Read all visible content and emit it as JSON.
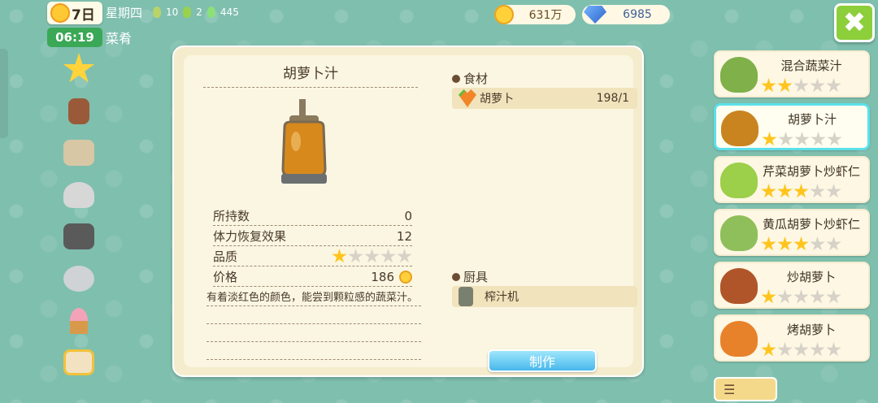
{
  "status": {
    "day": "7日",
    "time": "06:19",
    "weekday": "星期四",
    "stat1": "10",
    "stat2": "2",
    "stat3": "445",
    "category": "菜肴"
  },
  "currency": {
    "gold": "631万",
    "gems": "6985"
  },
  "close_label": "✖",
  "rail": [
    "star-icon",
    "drink-icon",
    "cutting-board-icon",
    "steamer-icon",
    "grill-icon",
    "pot-icon",
    "ice-cream-icon",
    "oven-icon"
  ],
  "item": {
    "title": "胡萝卜汁",
    "details": [
      {
        "label": "所持数",
        "value": "0"
      },
      {
        "label": "体力恢复效果",
        "value": "12"
      },
      {
        "label": "品质",
        "stars": 1
      },
      {
        "label": "价格",
        "value": "186"
      }
    ],
    "description": "有着淡红色的颜色，能尝到颗粒感的蔬菜汁。"
  },
  "ingredients": {
    "heading": "食材",
    "items": [
      {
        "name": "胡萝卜",
        "count": "198/1"
      }
    ]
  },
  "tools": {
    "heading": "厨具",
    "items": [
      {
        "name": "榨汁机"
      }
    ]
  },
  "make_button": "制作",
  "recipes": [
    {
      "name": "混合蔬菜汁",
      "stars": 2,
      "color": "#7fb04a"
    },
    {
      "name": "胡萝卜汁",
      "stars": 1,
      "color": "#c98420",
      "selected": true
    },
    {
      "name": "芹菜胡萝卜炒虾仁",
      "stars": 3,
      "color": "#9ccf4a"
    },
    {
      "name": "黄瓜胡萝卜炒虾仁",
      "stars": 3,
      "color": "#8fbf5a"
    },
    {
      "name": "炒胡萝卜",
      "stars": 1,
      "color": "#b0552a"
    },
    {
      "name": "烤胡萝卜",
      "stars": 1,
      "color": "#e8822a"
    }
  ],
  "list_toggle": "☰"
}
